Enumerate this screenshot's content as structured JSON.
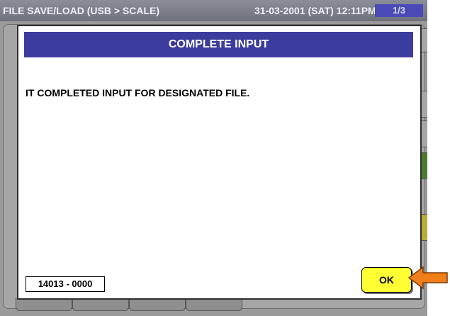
{
  "header": {
    "title": "FILE SAVE/LOAD (USB > SCALE)",
    "datetime": "31-03-2001 (SAT)  12:11PM",
    "page_indicator": "1/3"
  },
  "dialog": {
    "title": "COMPLETE INPUT",
    "message": "IT COMPLETED INPUT FOR DESIGNATED FILE.",
    "code": "14013 - 0000",
    "ok_label": "OK"
  },
  "colors": {
    "dialog_header": "#3c3c9e",
    "ok_button": "#ffff33",
    "pointer_arrow": "#f07f1a"
  },
  "icons": {
    "pointer": "arrow-left-icon"
  }
}
